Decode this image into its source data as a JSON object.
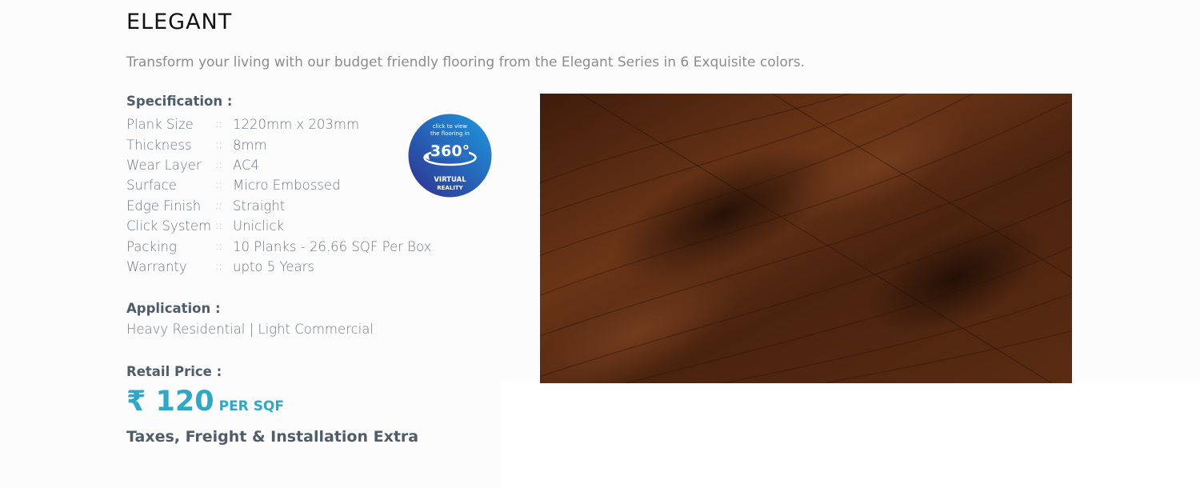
{
  "product": {
    "title": "ELEGANT",
    "subtitle": "Transform your living with our budget friendly flooring from the Elegant Series in 6 Exquisite colors."
  },
  "specification": {
    "heading": "Specification :",
    "separator": "::",
    "rows": [
      {
        "key": "Plank Size",
        "value": "1220mm x 203mm"
      },
      {
        "key": "Thickness",
        "value": "8mm"
      },
      {
        "key": "Wear Layer",
        "value": "AC4"
      },
      {
        "key": "Surface",
        "value": "Micro Embossed"
      },
      {
        "key": "Edge Finish",
        "value": "Straight"
      },
      {
        "key": "Click System",
        "value": "Uniclick"
      },
      {
        "key": "Packing",
        "value": "10 Planks - 26.66 SQF Per Box"
      },
      {
        "key": "Warranty",
        "value": "upto 5 Years"
      }
    ]
  },
  "vr_badge": {
    "line1": "click to view",
    "line2": "the flooring in",
    "degrees": "360°",
    "line3": "VIRTUAL",
    "line4": "REALITY",
    "colors": {
      "start": "#2f2f8f",
      "end": "#1e9ae0"
    }
  },
  "application": {
    "heading": "Application :",
    "value": "Heavy Residential | Light Commercial"
  },
  "price": {
    "heading": "Retail Price :",
    "amount": "₹ 120",
    "unit": "PER SQF",
    "note": "Taxes, Freight & Installation Extra"
  },
  "image": {
    "icon": "wood-floor-image",
    "colors": {
      "base": "#4a230f",
      "mid": "#6b3517",
      "dark": "#2a1208"
    }
  }
}
